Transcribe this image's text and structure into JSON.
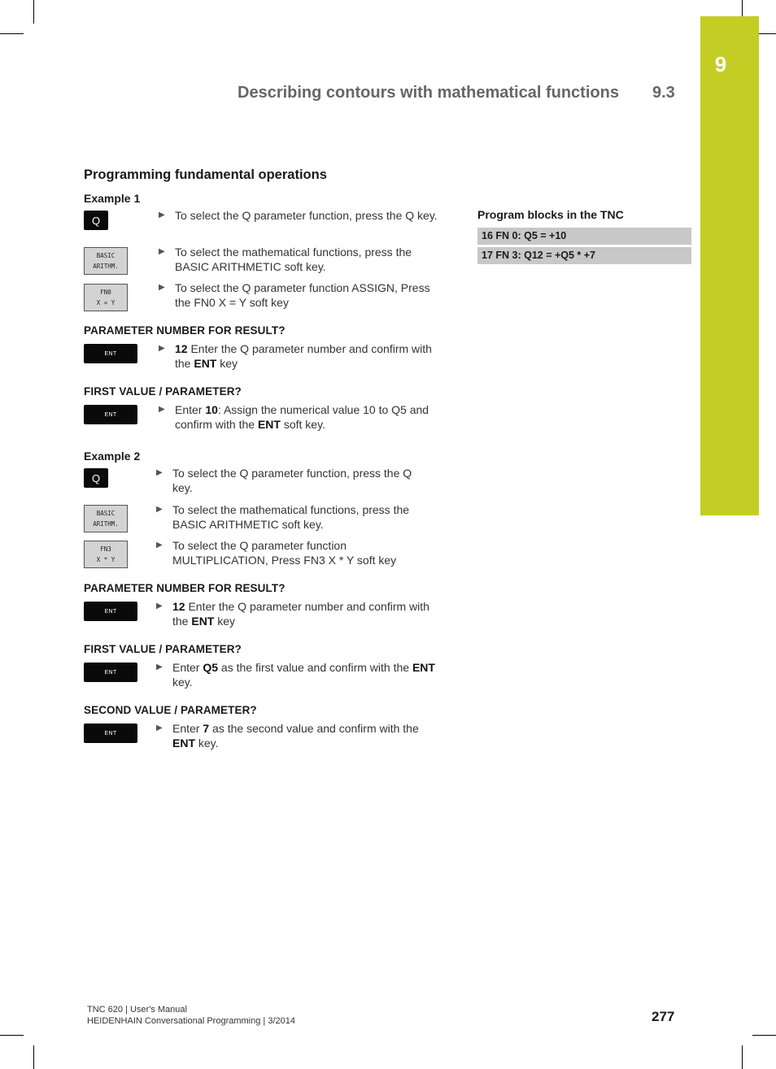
{
  "header": {
    "chapter_number": "9",
    "running_title": "Describing contours with mathematical functions",
    "section_number": "9.3",
    "accent_color": "#c3cd24"
  },
  "section_title": "Programming fundamental operations",
  "example1": {
    "title": "Example 1",
    "steps": [
      {
        "key_type": "hard-key",
        "key_label": "Q",
        "text": "To select the Q parameter function, press the Q key."
      },
      {
        "key_type": "soft-key",
        "key_lines": [
          "BASIC",
          "ARITHM."
        ],
        "text": "To select the mathematical functions, press the BASIC ARITHMETIC soft key."
      },
      {
        "key_type": "soft-key",
        "key_lines": [
          "FN0",
          "X = Y"
        ],
        "text": "To select the Q parameter function ASSIGN, Press the FN0 X = Y soft key"
      }
    ],
    "prompts": [
      {
        "label": "PARAMETER NUMBER FOR RESULT?",
        "key_label": "ENT",
        "bold_lead": "12",
        "text_a": " Enter the Q parameter number and confirm with the ",
        "bold_mid": "ENT",
        "text_b": " key"
      },
      {
        "label": "FIRST VALUE / PARAMETER?",
        "key_label": "ENT",
        "prefix": "Enter ",
        "bold_lead": "10",
        "text_a": ": Assign the numerical value 10 to Q5 and confirm with the ",
        "bold_mid": "ENT",
        "text_b": " soft key."
      }
    ]
  },
  "example2": {
    "title": "Example 2",
    "steps": [
      {
        "key_type": "hard-key",
        "key_label": "Q",
        "text": "To select the Q parameter function, press the Q key."
      },
      {
        "key_type": "soft-key",
        "key_lines": [
          "BASIC",
          "ARITHM."
        ],
        "text": "To select the mathematical functions, press the BASIC ARITHMETIC soft key."
      },
      {
        "key_type": "soft-key",
        "key_lines": [
          "FN3",
          "X * Y"
        ],
        "text": "To select the Q parameter function MULTIPLICATION, Press FN3 X * Y soft key"
      }
    ],
    "prompts": [
      {
        "label": "PARAMETER NUMBER FOR RESULT?",
        "key_label": "ENT",
        "bold_lead": "12",
        "text_a": " Enter the Q parameter number and confirm with the ",
        "bold_mid": "ENT",
        "text_b": " key"
      },
      {
        "label": "FIRST VALUE / PARAMETER?",
        "key_label": "ENT",
        "prefix": "Enter ",
        "bold_lead": "Q5",
        "text_a": " as the first value and confirm with the ",
        "bold_mid": "ENT",
        "text_b": " key."
      },
      {
        "label": "SECOND VALUE / PARAMETER?",
        "key_label": "ENT",
        "prefix": "Enter ",
        "bold_lead": "7",
        "text_a": " as the second value and confirm with the ",
        "bold_mid": "ENT",
        "text_b": " key."
      }
    ]
  },
  "program_blocks": {
    "title": "Program blocks in the TNC",
    "lines": [
      "16 FN 0: Q5 = +10",
      "17 FN 3: Q12 = +Q5 * +7"
    ]
  },
  "footer": {
    "line1": "TNC 620 | User's Manual",
    "line2": "HEIDENHAIN Conversational Programming | 3/2014",
    "page_number": "277"
  },
  "icons": {
    "bullet": "triangle-right-icon",
    "bullet_glyph": "▶"
  }
}
